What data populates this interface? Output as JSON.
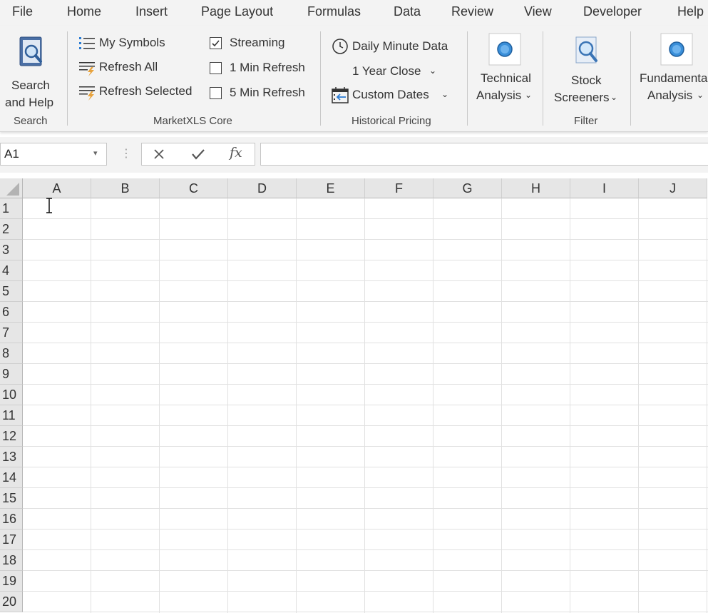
{
  "menu": {
    "items": [
      "File",
      "Home",
      "Insert",
      "Page Layout",
      "Formulas",
      "Data",
      "Review",
      "View",
      "Developer",
      "Help"
    ]
  },
  "ribbon": {
    "search_group": {
      "button_line1": "Search",
      "button_line2": "and Help",
      "label": "Search"
    },
    "core_group": {
      "my_symbols": "My Symbols",
      "refresh_all": "Refresh All",
      "refresh_selected": "Refresh Selected",
      "streaming": "Streaming",
      "streaming_checked": true,
      "one_min": "1 Min Refresh",
      "five_min": "5 Min Refresh",
      "label": "MarketXLS Core"
    },
    "historical_group": {
      "daily_minute": "Daily Minute Data",
      "year_close": "1 Year Close",
      "custom_dates": "Custom Dates",
      "label": "Historical Pricing"
    },
    "technical": {
      "line1": "Technical",
      "line2": "Analysis"
    },
    "filter_group": {
      "line1": "Stock",
      "line2": "Screeners",
      "label": "Filter"
    },
    "fundamental": {
      "line1": "Fundamental",
      "line2": "Analysis"
    }
  },
  "formula_bar": {
    "name_box": "A1",
    "cancel_icon": "close-icon",
    "enter_icon": "check-icon",
    "fx": "fx",
    "value": ""
  },
  "sheet": {
    "columns": [
      "A",
      "B",
      "C",
      "D",
      "E",
      "F",
      "G",
      "H",
      "I",
      "J"
    ],
    "rows": [
      "1",
      "2",
      "3",
      "4",
      "5",
      "6",
      "7",
      "8",
      "9",
      "10",
      "11",
      "12",
      "13",
      "14",
      "15",
      "16",
      "17",
      "18",
      "19",
      "20"
    ]
  },
  "colors": {
    "ribbon_bg": "#f3f3f3",
    "header_bg": "#e6e6e6",
    "gridline": "#e1e1e1",
    "accent_blue": "#2b7cd3",
    "lightning_orange": "#e8a33d"
  }
}
